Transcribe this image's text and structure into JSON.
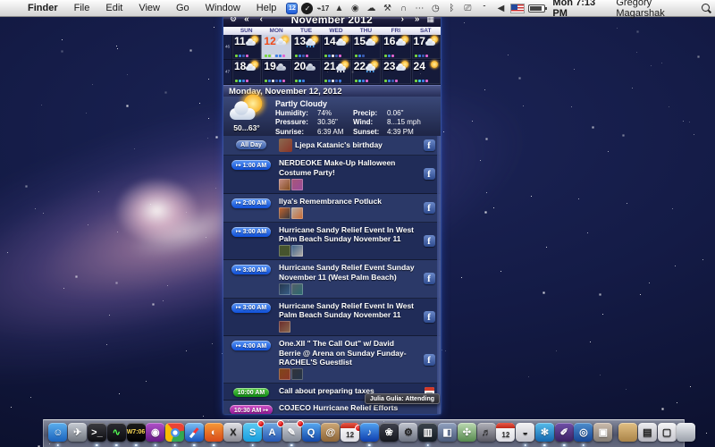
{
  "menu_bar": {
    "apple_logo": "",
    "menus": [
      "Finder",
      "File",
      "Edit",
      "View",
      "Go",
      "Window",
      "Help"
    ],
    "status_icons": [
      {
        "name": "ical-date-icon",
        "glyph": "12"
      },
      {
        "name": "black-circle-icon",
        "glyph": "✓"
      },
      {
        "name": "meter-icon",
        "glyph": "⌁17"
      },
      {
        "name": "backup-icon",
        "glyph": "▲"
      },
      {
        "name": "globe-icon",
        "glyph": "◉"
      },
      {
        "name": "cloud-icon",
        "glyph": "☁"
      },
      {
        "name": "wrench-icon",
        "glyph": "⚒"
      },
      {
        "name": "headphones-icon",
        "glyph": "∩"
      },
      {
        "name": "dots-icon",
        "glyph": "⋯"
      },
      {
        "name": "clock-icon",
        "glyph": "◷"
      },
      {
        "name": "bluetooth-icon",
        "glyph": "ᛒ"
      },
      {
        "name": "display-icon",
        "glyph": "⎚"
      },
      {
        "name": "wifi-icon",
        "glyph": ""
      },
      {
        "name": "volume-icon",
        "glyph": "◀"
      },
      {
        "name": "us-flag-icon",
        "glyph": ""
      },
      {
        "name": "battery-icon",
        "glyph": ""
      }
    ],
    "clock": "Mon 7:13 PM",
    "user": "Gregory Magarshak"
  },
  "calendar": {
    "title": "November 2012",
    "nav": {
      "settings": "⚙",
      "prev_year": "«",
      "prev_month": "‹",
      "next_month": "›",
      "next_year": "»",
      "panel": "▦"
    },
    "day_names": [
      "SUN",
      "MON",
      "TUE",
      "WED",
      "THU",
      "FRI",
      "SAT"
    ],
    "week_numbers": [
      "46",
      "47"
    ],
    "dot_colors": {
      "g": "#76d73e",
      "b": "#3f80e8",
      "w": "#e9e9ef",
      "p": "#e265cf",
      "c": "#3cc9ea",
      "d": "#3a5cb0"
    },
    "weeks": [
      [
        {
          "day": "11",
          "weather": "partly",
          "dots": [
            "g",
            "b",
            "d",
            "p"
          ]
        },
        {
          "day": "12",
          "weather": "partly",
          "selected": true,
          "dots": [
            "g",
            "g",
            "w",
            "b",
            "b",
            "p"
          ]
        },
        {
          "day": "13",
          "weather": "rain",
          "dots": [
            "g",
            "b",
            "d",
            "p"
          ]
        },
        {
          "day": "14",
          "weather": "partly",
          "dots": [
            "g",
            "b",
            "w",
            "d",
            "p"
          ]
        },
        {
          "day": "15",
          "weather": "partly",
          "dots": [
            "g",
            "b",
            "d"
          ]
        },
        {
          "day": "16",
          "weather": "partly",
          "dots": [
            "g",
            "b",
            "p"
          ]
        },
        {
          "day": "17",
          "weather": "partly",
          "dots": [
            "g",
            "b",
            "d",
            "p"
          ]
        }
      ],
      [
        {
          "day": "18",
          "weather": "partly",
          "dots": [
            "g",
            "c",
            "b",
            "p"
          ]
        },
        {
          "day": "19",
          "weather": "cloudy",
          "dots": [
            "g",
            "b",
            "w",
            "d",
            "b",
            "p"
          ]
        },
        {
          "day": "20",
          "weather": "cloudy",
          "dots": [
            "g",
            "c",
            "b"
          ]
        },
        {
          "day": "21",
          "weather": "snow",
          "dots": [
            "g",
            "b",
            "w",
            "d",
            "b"
          ]
        },
        {
          "day": "22",
          "weather": "rain",
          "dots": [
            "g",
            "c",
            "b",
            "p"
          ]
        },
        {
          "day": "23",
          "weather": "partly",
          "dots": [
            "g",
            "b",
            "d",
            "p"
          ]
        },
        {
          "day": "24",
          "weather": "sun",
          "dots": [
            "g",
            "c",
            "b",
            "p"
          ]
        }
      ]
    ]
  },
  "selected_date_bar": "Monday, November 12, 2012",
  "weather_panel": {
    "condition": "Partly Cloudy",
    "temp_range": "50...63°",
    "humidity_label": "Humidity:",
    "humidity": "74%",
    "precip_label": "Precip:",
    "precip": "0.06\"",
    "pressure_label": "Pressure:",
    "pressure": "30.36\"",
    "wind_label": "Wind:",
    "wind": "8...15 mph",
    "sunrise_label": "Sunrise:",
    "sunrise": "6:39 AM",
    "sunset_label": "Sunset:",
    "sunset": "4:39 PM"
  },
  "events": [
    {
      "time": "All Day",
      "style": "allday",
      "arrow": "none",
      "title": "Ljepa Katanic's birthday",
      "inline_avatar": true,
      "avatars": 0,
      "icon": "facebook"
    },
    {
      "time": "1:00 AM",
      "style": "blue",
      "arrow": "before",
      "title": "NERDEOKE Make-Up Halloween Costume Party!",
      "avatars": 2,
      "icon": "facebook"
    },
    {
      "time": "2:00 AM",
      "style": "blue",
      "arrow": "before",
      "title": "Ilya's Remembrance Potluck",
      "avatars": 2,
      "icon": "facebook"
    },
    {
      "time": "3:00 AM",
      "style": "blue",
      "arrow": "before",
      "title": "Hurricane Sandy Relief Event In West Palm Beach Sunday November 11",
      "avatars": 2,
      "icon": "facebook"
    },
    {
      "time": "3:00 AM",
      "style": "blue",
      "arrow": "before",
      "title": "Hurricane Sandy Relief Event Sunday November 11 (West Palm Beach)",
      "avatars": 2,
      "icon": "facebook"
    },
    {
      "time": "3:00 AM",
      "style": "blue",
      "arrow": "before",
      "title": "Hurricane Sandy Relief Event In West Palm Beach Sunday November 11",
      "avatars": 1,
      "icon": "facebook"
    },
    {
      "time": "4:00 AM",
      "style": "blue",
      "arrow": "before",
      "title": "One.XII \" The Call Out\" w/ David Berrie @ Arena on Sunday Funday- RACHEL'S Guestlist",
      "avatars": 2,
      "icon": "facebook"
    },
    {
      "time": "10:00 AM",
      "style": "green",
      "arrow": "none",
      "title": "Call about preparing taxes",
      "avatars": 0,
      "icon": "ical"
    },
    {
      "time": "10:30 AM",
      "style": "magenta",
      "arrow": "after",
      "title": "COJECO Hurricane Relief Efforts",
      "avatars": 0,
      "avatar_rows": [
        12,
        12,
        9
      ],
      "icon": "facebook",
      "tooltip": "Julia Gulia: Attending"
    }
  ],
  "avatar_palette": [
    "#8a6a50",
    "#32343a",
    "#c89088",
    "#58406a",
    "#c86830",
    "#8a3428",
    "#46542e",
    "#a85878",
    "#24344a",
    "#b8b0a8",
    "#6a2a2a",
    "#38608a",
    "#804818",
    "#555f68",
    "#2a6a70",
    "#9a4a9a"
  ],
  "dock": {
    "items": [
      {
        "name": "finder",
        "glyph": "☺",
        "c1": "#5cb0ee",
        "c2": "#1a62bc",
        "running": true
      },
      {
        "name": "launchpad",
        "glyph": "✈",
        "c1": "#c8ccd4",
        "c2": "#70767f"
      },
      {
        "name": "terminal",
        "glyph": ">_",
        "c1": "#3c3c42",
        "c2": "#0c0c10",
        "running": true
      },
      {
        "name": "activity-monitor",
        "glyph": "∿",
        "c1": "#2c2c32",
        "c2": "#0a0a0e",
        "running": true,
        "glyph_class": "glyph-green"
      },
      {
        "name": "istat",
        "glyph": "W7:06",
        "c1": "#1c1c1c",
        "c2": "#000000",
        "running": true,
        "glyph_class": "glyph-yellow"
      },
      {
        "name": "photo-booth",
        "glyph": "◉",
        "c1": "#b050c8",
        "c2": "#651a86",
        "running": true
      },
      {
        "name": "google-chrome",
        "glyph": "",
        "c1": "#fff",
        "c2": "#fff",
        "running": true
      },
      {
        "name": "safari",
        "glyph": "",
        "c1": "#7cc0f4",
        "c2": "#1956c0",
        "running": true
      },
      {
        "name": "firefox",
        "glyph": "◐",
        "c1": "#f89a38",
        "c2": "#d84a18",
        "running": true
      },
      {
        "name": "x11",
        "glyph": "X",
        "c1": "#e2e2e6",
        "c2": "#8a8a92",
        "glyph_class": "glyph-dark"
      },
      {
        "name": "skype",
        "glyph": "S",
        "c1": "#5ecaf2",
        "c2": "#169fdf",
        "badge": true,
        "running": true
      },
      {
        "name": "app-store",
        "glyph": "A",
        "c1": "#72aae2",
        "c2": "#2456b2",
        "badge": true
      },
      {
        "name": "sketch-app",
        "glyph": "✎",
        "c1": "#ced2da",
        "c2": "#838a96",
        "badge": true,
        "running": true
      },
      {
        "name": "quicktime",
        "glyph": "Q",
        "c1": "#58aaf2",
        "c2": "#1246a6"
      },
      {
        "name": "contacts",
        "glyph": "@",
        "c1": "#cea876",
        "c2": "#8c6436"
      },
      {
        "name": "ical-dock",
        "glyph": "12",
        "c1": "#fff",
        "c2": "#dcdce2",
        "badge": true,
        "running": true
      },
      {
        "name": "itunes",
        "glyph": "♪",
        "c1": "#52a4f2",
        "c2": "#0e3eae",
        "running": true
      },
      {
        "name": "iphoto",
        "glyph": "❀",
        "c1": "#40424e",
        "c2": "#16181f"
      },
      {
        "name": "system-preferences",
        "glyph": "⚙",
        "c1": "#c2c6d0",
        "c2": "#6c7280",
        "glyph_class": "glyph-dark"
      },
      {
        "name": "stats-app",
        "glyph": "▥",
        "c1": "#3c444c",
        "c2": "#141c24",
        "running": true
      },
      {
        "name": "blue-utility",
        "glyph": "◧",
        "c1": "#92a2c0",
        "c2": "#4a5a7a"
      },
      {
        "name": "green-utility",
        "glyph": "✣",
        "c1": "#bcdab2",
        "c2": "#568a4e"
      },
      {
        "name": "garageband",
        "glyph": "♬",
        "c1": "#b2b2ba",
        "c2": "#585862",
        "glyph_class": "glyph-dark"
      },
      {
        "name": "ical-dock2",
        "glyph": "12",
        "c1": "#fff",
        "c2": "#dcdce2",
        "running": true
      },
      {
        "name": "paint-can",
        "glyph": "◒",
        "c1": "#f2f2f4",
        "c2": "#c2c2ca",
        "glyph_class": "glyph-dark",
        "running": true
      },
      {
        "name": "snowflake-app",
        "glyph": "✻",
        "c1": "#56bcea",
        "c2": "#1466ae",
        "running": true
      },
      {
        "name": "purple-brush",
        "glyph": "✐",
        "c1": "#7050a8",
        "c2": "#3a2262",
        "running": true
      },
      {
        "name": "time-machine",
        "glyph": "◎",
        "c1": "#4e8ecc",
        "c2": "#164696",
        "running": true
      },
      {
        "name": "collage-app",
        "glyph": "▣",
        "c1": "#ccbcac",
        "c2": "#847c74"
      },
      {
        "name": "sep",
        "sep": true
      },
      {
        "name": "folder-downloads",
        "glyph": "",
        "c1": "#e2c084",
        "c2": "#aa8448"
      },
      {
        "name": "stack-documents",
        "glyph": "▤",
        "c1": "#ececf0",
        "c2": "#b4b4bc",
        "glyph_class": "glyph-dark"
      },
      {
        "name": "stack-pages",
        "glyph": "▢",
        "c1": "#f4f4f6",
        "c2": "#c6c6ce",
        "glyph_class": "glyph-dark"
      },
      {
        "name": "trash",
        "glyph": "",
        "c1": "#eceef2",
        "c2": "#9aa0aa"
      }
    ]
  }
}
